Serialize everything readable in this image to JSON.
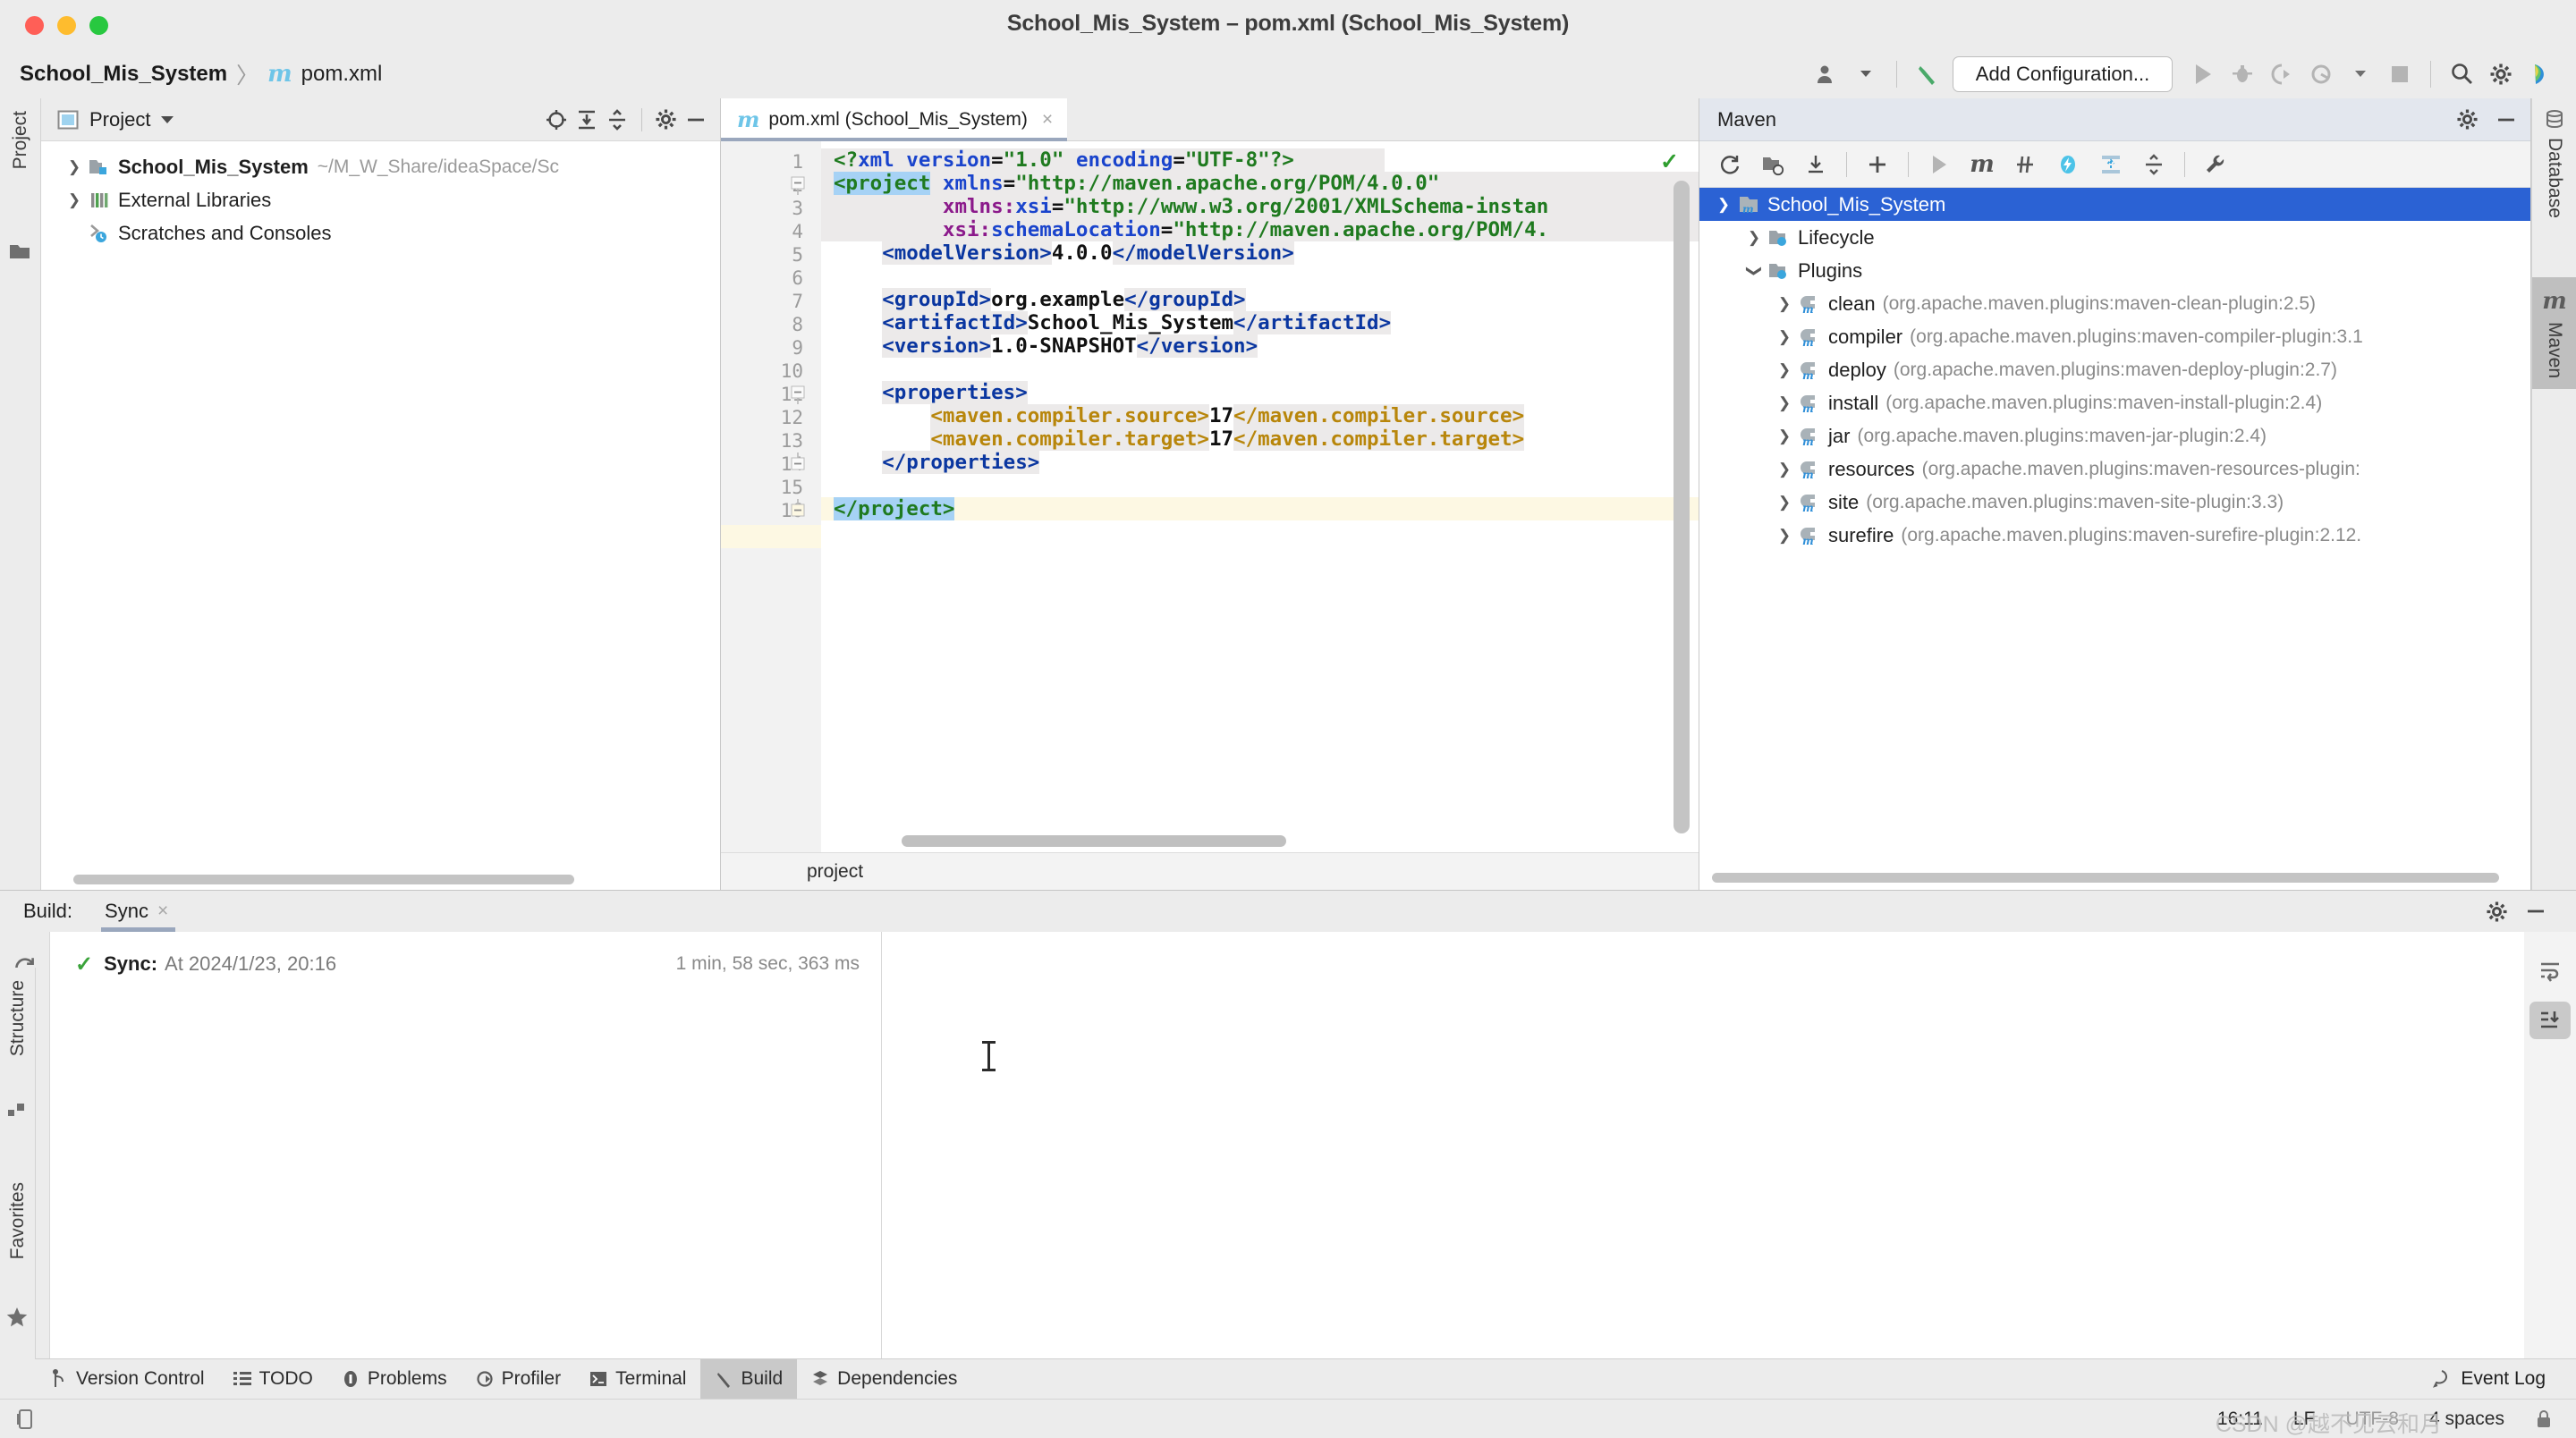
{
  "window": {
    "title": "School_Mis_System – pom.xml (School_Mis_System)",
    "traffic_lights": [
      "close",
      "minimize",
      "zoom"
    ]
  },
  "navbar": {
    "breadcrumb_project": "School_Mis_System",
    "breadcrumb_separator": "〉",
    "maven_glyph": "m",
    "breadcrumb_file": "pom.xml",
    "run_configuration_label": "Add Configuration...",
    "icons": [
      "user-account-icon",
      "chevron-down-icon",
      "build-hammer-icon",
      "run-icon",
      "debug-icon",
      "run-coverage-icon",
      "profile-icon",
      "chevron-down-icon",
      "stop-icon",
      "search-icon",
      "gear-icon",
      "ide-feedback-icon"
    ]
  },
  "left_strip": {
    "labels": [
      "Project"
    ],
    "bottom_labels": [
      "Structure",
      "Favorites"
    ]
  },
  "project_panel": {
    "title": "Project",
    "header_icons": [
      "locate-icon",
      "expand-all-icon",
      "collapse-all-icon",
      "gear-icon",
      "minimize-icon"
    ],
    "tree": [
      {
        "label": "School_Mis_System",
        "path": "~/M_W_Share/ideaSpace/Sc",
        "icon": "module-folder-icon",
        "expandable": true,
        "bold": true
      },
      {
        "label": "External Libraries",
        "path": "",
        "icon": "libraries-icon",
        "expandable": true,
        "bold": false
      },
      {
        "label": "Scratches and Consoles",
        "path": "",
        "icon": "scratches-icon",
        "expandable": false,
        "bold": false
      }
    ]
  },
  "editor": {
    "tab": {
      "label": "pom.xml (School_Mis_System)",
      "icon": "maven-file-icon",
      "close": "×"
    },
    "inspection_status": "ok",
    "breadcrumb": "project",
    "lines": [
      {
        "n": 1,
        "text": "<?xml version=\"1.0\" encoding=\"UTF-8\"?>"
      },
      {
        "n": 2,
        "text": "<project xmlns=\"http://maven.apache.org/POM/4.0.0\""
      },
      {
        "n": 3,
        "text": "         xmlns:xsi=\"http://www.w3.org/2001/XMLSchema-instan"
      },
      {
        "n": 4,
        "text": "         xsi:schemaLocation=\"http://maven.apache.org/POM/4."
      },
      {
        "n": 5,
        "text": "    <modelVersion>4.0.0</modelVersion>"
      },
      {
        "n": 6,
        "text": ""
      },
      {
        "n": 7,
        "text": "    <groupId>org.example</groupId>"
      },
      {
        "n": 8,
        "text": "    <artifactId>School_Mis_System</artifactId>"
      },
      {
        "n": 9,
        "text": "    <version>1.0-SNAPSHOT</version>"
      },
      {
        "n": 10,
        "text": ""
      },
      {
        "n": 11,
        "text": "    <properties>"
      },
      {
        "n": 12,
        "text": "        <maven.compiler.source>17</maven.compiler.source>"
      },
      {
        "n": 13,
        "text": "        <maven.compiler.target>17</maven.compiler.target>"
      },
      {
        "n": 14,
        "text": "    </properties>"
      },
      {
        "n": 15,
        "text": ""
      },
      {
        "n": 16,
        "text": "</project>"
      }
    ]
  },
  "maven_panel": {
    "title": "Maven",
    "header_icons": [
      "gear-icon",
      "minimize-icon"
    ],
    "toolbar_icons": [
      "reload-all-icon",
      "add-maven-project-icon",
      "download-sources-icon",
      "plus-icon",
      "run-icon",
      "execute-goal-icon",
      "skip-tests-icon",
      "toggle-offline-icon",
      "expand-all-icon",
      "collapse-all-icon",
      "settings-wrench-icon"
    ],
    "tree": {
      "root": {
        "label": "School_Mis_System",
        "icon": "maven-project-icon",
        "expanded": true,
        "selected": true
      },
      "children": [
        {
          "label": "Lifecycle",
          "icon": "phase-folder-icon",
          "expanded": false,
          "detail": ""
        },
        {
          "label": "Plugins",
          "icon": "plugin-folder-icon",
          "expanded": true,
          "detail": ""
        }
      ],
      "plugins": [
        {
          "label": "clean",
          "detail": "(org.apache.maven.plugins:maven-clean-plugin:2.5)"
        },
        {
          "label": "compiler",
          "detail": "(org.apache.maven.plugins:maven-compiler-plugin:3.1"
        },
        {
          "label": "deploy",
          "detail": "(org.apache.maven.plugins:maven-deploy-plugin:2.7)"
        },
        {
          "label": "install",
          "detail": "(org.apache.maven.plugins:maven-install-plugin:2.4)"
        },
        {
          "label": "jar",
          "detail": "(org.apache.maven.plugins:maven-jar-plugin:2.4)"
        },
        {
          "label": "resources",
          "detail": "(org.apache.maven.plugins:maven-resources-plugin:"
        },
        {
          "label": "site",
          "detail": "(org.apache.maven.plugins:maven-site-plugin:3.3)"
        },
        {
          "label": "surefire",
          "detail": "(org.apache.maven.plugins:maven-surefire-plugin:2.12."
        }
      ]
    }
  },
  "right_strip": {
    "tabs": [
      {
        "label": "Database",
        "icon": "database-icon",
        "active": false
      },
      {
        "label": "Maven",
        "icon": "maven-m-icon",
        "active": true
      }
    ]
  },
  "build_panel": {
    "label": "Build:",
    "tab": {
      "label": "Sync",
      "close": "×"
    },
    "header_icons": [
      "gear-icon",
      "minimize-icon"
    ],
    "side_icons": [
      "rerun-icon",
      "pin-icon",
      "eye-filter-icon"
    ],
    "right_icons": [
      "soft-wrap-icon",
      "scroll-to-end-icon"
    ],
    "sync": {
      "status_icon": "check-green-icon",
      "title": "Sync:",
      "detail": "At 2024/1/23, 20:16",
      "duration": "1 min, 58 sec, 363 ms"
    }
  },
  "bottom_tabs": {
    "items": [
      {
        "label": "Version Control",
        "icon": "branch-icon",
        "active": false
      },
      {
        "label": "TODO",
        "icon": "todo-list-icon",
        "active": false
      },
      {
        "label": "Problems",
        "icon": "problems-icon",
        "active": false
      },
      {
        "label": "Profiler",
        "icon": "profiler-icon",
        "active": false
      },
      {
        "label": "Terminal",
        "icon": "terminal-icon",
        "active": false
      },
      {
        "label": "Build",
        "icon": "build-hammer-icon",
        "active": true
      },
      {
        "label": "Dependencies",
        "icon": "dependencies-icon",
        "active": false
      }
    ],
    "right": {
      "label": "Event Log",
      "icon": "event-log-icon"
    }
  },
  "statusbar": {
    "left_icon": "memory-indicator-icon",
    "position": "16:11",
    "line_separator": "LF",
    "encoding": "UTF-8",
    "indent": "4 spaces",
    "lock_icon": "lock-icon",
    "watermark": "CSDN @越不见云和月"
  },
  "colors": {
    "accent_blue": "#2b62d4",
    "selection_blue": "#a6d2f5",
    "tag_blue": "#0a36a0",
    "string_green": "#1f7a1f",
    "attr_blue": "#1a44cc",
    "ns_purple": "#8b1a8b",
    "olive": "#b8860b",
    "caret_line": "#fdf8e3",
    "ok_green": "#2f9e2f",
    "panel_bg": "#ececec"
  }
}
